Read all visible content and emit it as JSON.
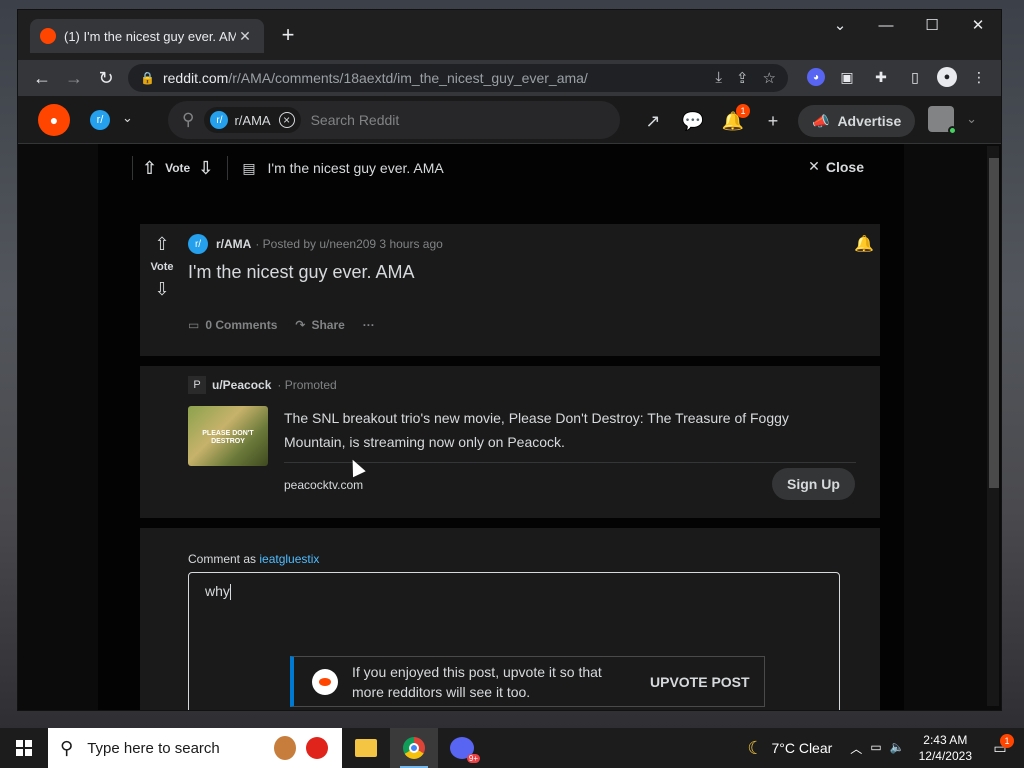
{
  "browser": {
    "tab_title": "(1) I'm the nicest guy ever. AMA",
    "tab_close": "✕",
    "new_tab": "+",
    "url_domain": "reddit.com",
    "url_path": "/r/AMA/comments/18aextd/im_the_nicest_guy_ever_ama/"
  },
  "reddit_header": {
    "community_chip": "r/AMA",
    "search_placeholder": "Search Reddit",
    "notification_count": "1",
    "advertise_label": "Advertise"
  },
  "overlay_header": {
    "vote_label": "Vote",
    "title": "I'm the nicest guy ever. AMA",
    "close_label": "Close"
  },
  "post": {
    "vote_label": "Vote",
    "subreddit": "r/AMA",
    "posted_by": "· Posted by u/neen209 3 hours ago",
    "title": "I'm the nicest guy ever. AMA",
    "comments_label": "0 Comments",
    "share_label": "Share",
    "more_label": "···"
  },
  "ad": {
    "favicon_letter": "P",
    "user": "u/Peacock",
    "promoted": "· Promoted",
    "thumb_text": "PLEASE DON'T DESTROY",
    "text": "The SNL breakout trio's new movie, Please Don't Destroy: The Treasure of Foggy Mountain, is streaming now only on Peacock.",
    "link": "peacocktv.com",
    "cta": "Sign Up"
  },
  "comment": {
    "prefix": "Comment as ",
    "username": "ieatgluestix",
    "text": "why"
  },
  "toast": {
    "message": "If you enjoyed this post, upvote it so that more redditors will see it too.",
    "button": "UPVOTE POST"
  },
  "taskbar": {
    "search_placeholder": "Type here to search",
    "weather": "7°C  Clear",
    "time": "2:43 AM",
    "date": "12/4/2023",
    "notification_count": "1",
    "discord_badge": "9+"
  },
  "colors": {
    "reddit_orange": "#ff4500",
    "link_blue": "#4fbcff",
    "toast_accent": "#0079d3"
  }
}
